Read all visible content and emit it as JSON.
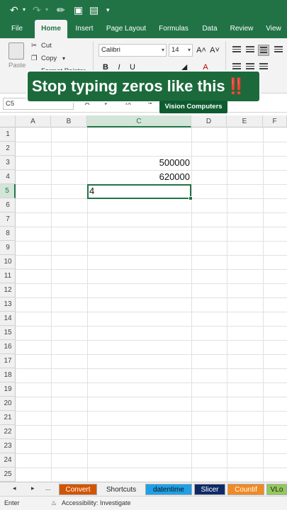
{
  "ribbon_tabs": [
    "File",
    "Home",
    "Insert",
    "Page Layout",
    "Formulas",
    "Data",
    "Review",
    "View"
  ],
  "clipboard": {
    "paste": "Paste",
    "cut": "Cut",
    "copy": "Copy",
    "format_painter": "Format Painter"
  },
  "font": {
    "name": "Calibri",
    "size": "14",
    "grow": "A˄",
    "shrink": "A˅",
    "bold": "B",
    "italic": "I",
    "underline": "U",
    "font_color": "A"
  },
  "banner": {
    "text": "Stop typing zeros like this",
    "mark": "‼️",
    "credit": "Vision Computers"
  },
  "formula_bar": {
    "name_box": "C5",
    "fx": "fx",
    "value": "4"
  },
  "columns": [
    "A",
    "B",
    "C",
    "D",
    "E",
    "F"
  ],
  "rows": [
    "1",
    "2",
    "3",
    "4",
    "5",
    "6",
    "7",
    "8",
    "9",
    "10",
    "11",
    "12",
    "13",
    "14",
    "15",
    "16",
    "17",
    "18",
    "19",
    "20",
    "21",
    "22",
    "23",
    "24",
    "25"
  ],
  "cells": {
    "C3": "500000",
    "C4": "620000",
    "C5": "4"
  },
  "sheet_tabs": [
    {
      "label": "Convert",
      "color": "#d35400",
      "text": "#ffffff"
    },
    {
      "label": "Shortcuts",
      "color": "#f0f0f0",
      "text": "#222222"
    },
    {
      "label": "datentime",
      "color": "#1ea0e6",
      "text": "#111111"
    },
    {
      "label": "Slicer",
      "color": "#0e2a66",
      "text": "#ffffff"
    },
    {
      "label": "Countif",
      "color": "#f08a24",
      "text": "#ffffff"
    },
    {
      "label": "VLo",
      "color": "#92c85a",
      "text": "#222222"
    }
  ],
  "sheet_nav": {
    "prev": "◂",
    "next": "▸",
    "more": "..."
  },
  "status": {
    "mode": "Enter",
    "accessibility": "Accessibility: Investigate"
  },
  "colors": {
    "excel_green": "#217346",
    "banner_bg": "#1c6a3b",
    "selected_header": "#d3e5d9"
  }
}
